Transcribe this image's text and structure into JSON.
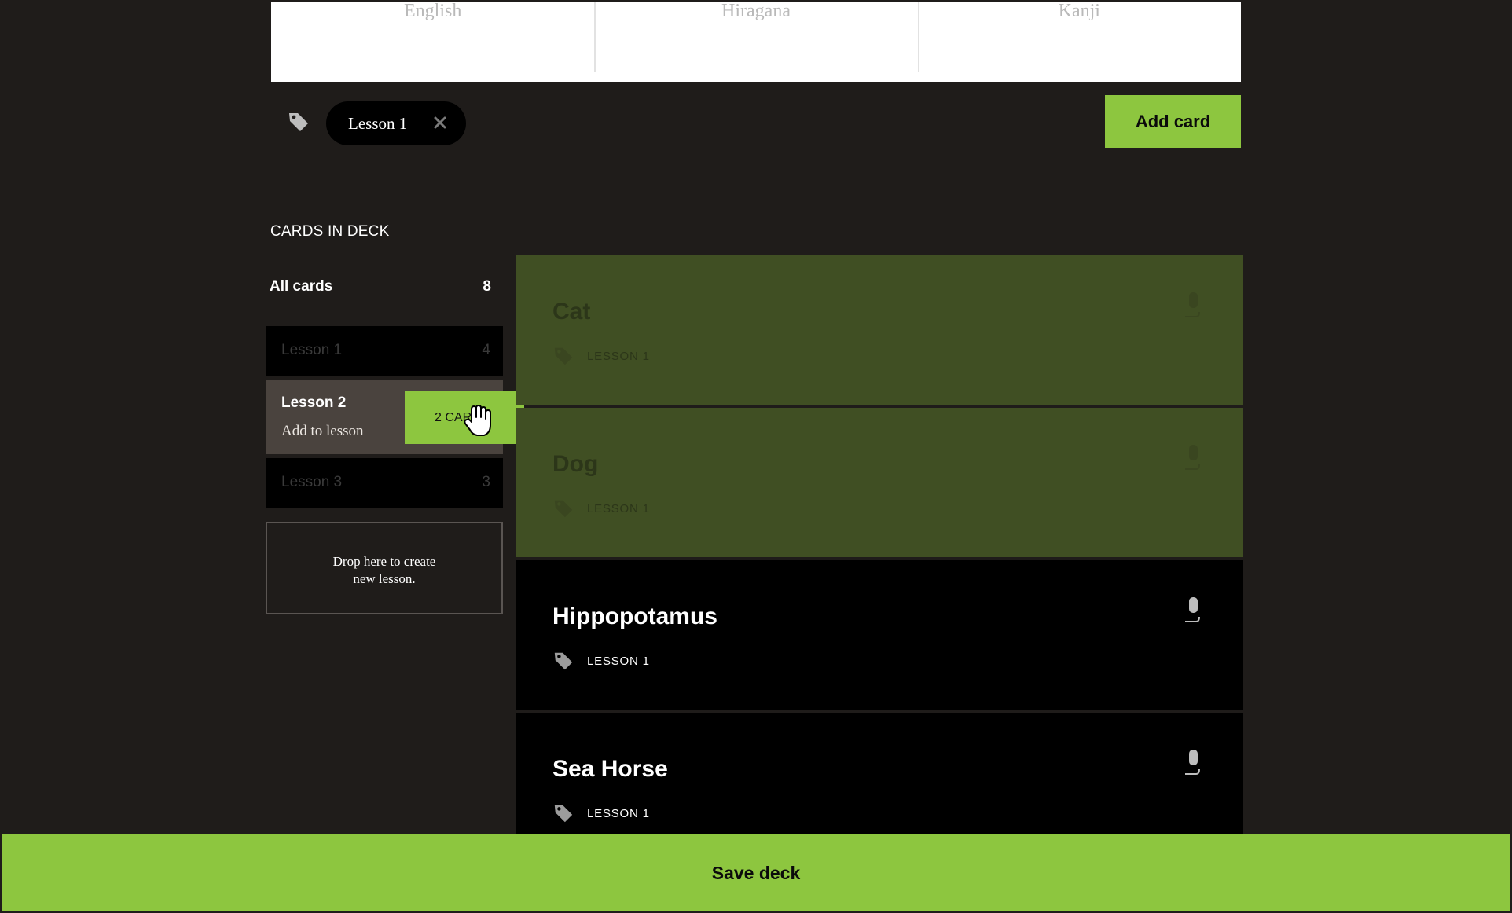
{
  "fields": [
    "English",
    "Hiragana",
    "Kanji"
  ],
  "tag_filter": {
    "label": "Lesson 1"
  },
  "add_card_label": "Add card",
  "deck_heading": "CARDS IN DECK",
  "all_cards": {
    "label": "All cards",
    "count": "8"
  },
  "lessons": [
    {
      "name": "Lesson 1",
      "count": "4"
    },
    {
      "name": "Lesson 2",
      "sub": "Add to lesson"
    },
    {
      "name": "Lesson 3",
      "count": "3"
    }
  ],
  "drag_chip_label": "2 CARDS",
  "drop_zone": {
    "line1": "Drop here to create",
    "line2": "new lesson."
  },
  "cards": [
    {
      "title": "Cat",
      "tag": "LESSON 1",
      "selected": true
    },
    {
      "title": "Dog",
      "tag": "LESSON 1",
      "selected": true
    },
    {
      "title": "Hippopotamus",
      "tag": "LESSON 1",
      "selected": false
    },
    {
      "title": "Sea Horse",
      "tag": "LESSON 1",
      "selected": false
    }
  ],
  "save_label": "Save deck",
  "colors": {
    "accent": "#8dc63f",
    "selected_card": "#404f23",
    "background": "#1f1c1a"
  }
}
